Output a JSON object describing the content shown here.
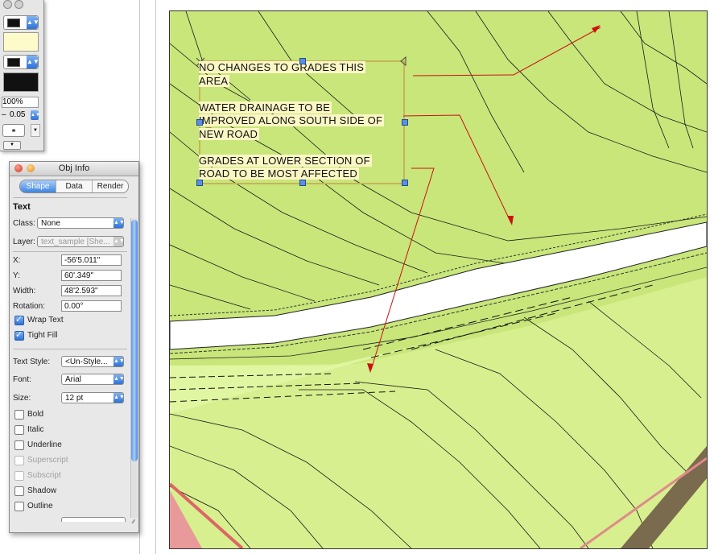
{
  "attributes_palette": {
    "opacity": "100%",
    "line_weight": "0.05",
    "fill_color": "#fdfbc9",
    "pen_color": "#111111"
  },
  "obj_info": {
    "title": "Obj Info",
    "tabs": [
      {
        "label": "Shape",
        "selected": true
      },
      {
        "label": "Data",
        "selected": false
      },
      {
        "label": "Render",
        "selected": false
      }
    ],
    "object_type": "Text",
    "class_label": "Class:",
    "class_value": "None",
    "layer_label": "Layer:",
    "layer_value": "text_sample [She...",
    "x_label": "X:",
    "x_value": "-56'5.011\"",
    "y_label": "Y:",
    "y_value": "60'.349\"",
    "width_label": "Width:",
    "width_value": "48'2.593\"",
    "rotation_label": "Rotation:",
    "rotation_value": "0.00°",
    "wrap_text": {
      "label": "Wrap Text",
      "checked": true
    },
    "tight_fill": {
      "label": "Tight Fill",
      "checked": true
    },
    "text_style_label": "Text Style:",
    "text_style_value": "<Un-Style...",
    "font_label": "Font:",
    "font_value": "Arial",
    "size_label": "Size:",
    "size_value": "12 pt",
    "style_options": [
      {
        "label": "Bold",
        "checked": false,
        "enabled": true
      },
      {
        "label": "Italic",
        "checked": false,
        "enabled": true
      },
      {
        "label": "Underline",
        "checked": false,
        "enabled": true
      },
      {
        "label": "Superscript",
        "checked": false,
        "enabled": false
      },
      {
        "label": "Subscript",
        "checked": false,
        "enabled": false
      },
      {
        "label": "Shadow",
        "checked": false,
        "enabled": true
      },
      {
        "label": "Outline",
        "checked": false,
        "enabled": true
      }
    ]
  },
  "drawing": {
    "terrain_color": "#c8e67a",
    "road_color": "#ffffff",
    "note_lines": [
      "NO CHANGES TO GRADES THIS",
      "AREA",
      "",
      "WATER DRAINAGE TO BE",
      "IMPROVED ALONG SOUTH SIDE OF",
      "NEW ROAD",
      "",
      "GRADES AT LOWER SECTION OF",
      "ROAD TO BE MOST AFFECTED"
    ],
    "arrow_color": "#cc1111"
  }
}
